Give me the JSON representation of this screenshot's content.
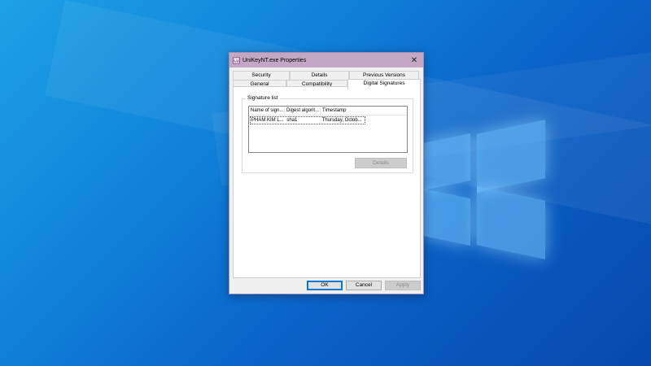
{
  "window": {
    "title": "UniKeyNT.exe Properties",
    "close_symbol": "✕"
  },
  "tabs": {
    "row1": [
      "Security",
      "Details",
      "Previous Versions"
    ],
    "row2": [
      "General",
      "Compatibility",
      "Digital Signatures"
    ],
    "active": "Digital Signatures"
  },
  "signature_list": {
    "group_label": "Signature list",
    "columns": [
      "Name of sign...",
      "Digest algorit...",
      "Timestamp"
    ],
    "rows": [
      [
        "PHAM KIM L...",
        "sha1",
        "Thursday, Octob..."
      ]
    ],
    "details_label": "Details"
  },
  "footer": {
    "ok_label": "OK",
    "cancel_label": "Cancel",
    "apply_label": "Apply"
  },
  "colors": {
    "titlebar": "#c4a7c5",
    "ok_focus": "#0078d7",
    "desktop": "#0a63c8"
  },
  "icons": {
    "title_icon": "unikey-app-icon",
    "close": "close-icon"
  }
}
